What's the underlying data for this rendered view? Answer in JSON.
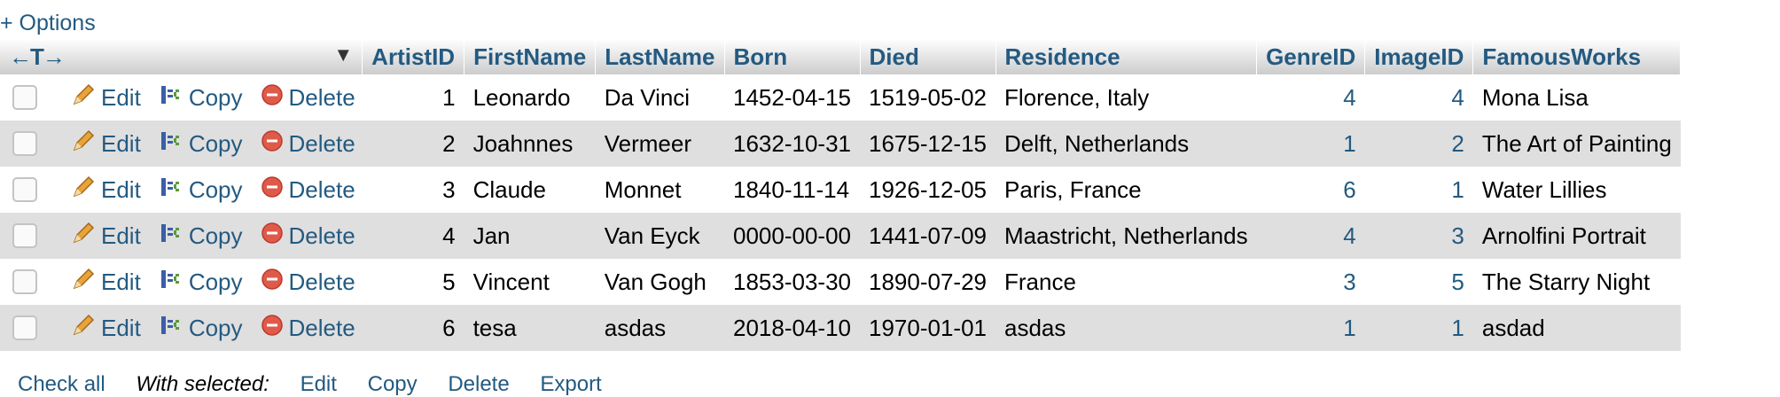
{
  "options_label": "+ Options",
  "toolbar": {
    "sort_arrows": "←T→"
  },
  "columns": [
    "ArtistID",
    "FirstName",
    "LastName",
    "Born",
    "Died",
    "Residence",
    "GenreID",
    "ImageID",
    "FamousWorks"
  ],
  "row_actions": {
    "edit": "Edit",
    "copy": "Copy",
    "delete": "Delete"
  },
  "rows": [
    {
      "id": "1",
      "first": "Leonardo",
      "last": "Da Vinci",
      "born": "1452-04-15",
      "died": "1519-05-02",
      "residence": "Florence, Italy",
      "genre": "4",
      "image": "4",
      "works": "Mona Lisa"
    },
    {
      "id": "2",
      "first": "Joahnnes",
      "last": "Vermeer",
      "born": "1632-10-31",
      "died": "1675-12-15",
      "residence": "Delft, Netherlands",
      "genre": "1",
      "image": "2",
      "works": "The Art of Painting"
    },
    {
      "id": "3",
      "first": "Claude",
      "last": "Monnet",
      "born": "1840-11-14",
      "died": "1926-12-05",
      "residence": "Paris, France",
      "genre": "6",
      "image": "1",
      "works": "Water Lillies"
    },
    {
      "id": "4",
      "first": "Jan",
      "last": "Van Eyck",
      "born": "0000-00-00",
      "died": "1441-07-09",
      "residence": "Maastricht, Netherlands",
      "genre": "4",
      "image": "3",
      "works": "Arnolfini Portrait"
    },
    {
      "id": "5",
      "first": "Vincent",
      "last": "Van Gogh",
      "born": "1853-03-30",
      "died": "1890-07-29",
      "residence": "France",
      "genre": "3",
      "image": "5",
      "works": "The Starry Night"
    },
    {
      "id": "6",
      "first": "tesa",
      "last": "asdas",
      "born": "2018-04-10",
      "died": "1970-01-01",
      "residence": "asdas",
      "genre": "1",
      "image": "1",
      "works": "asdad"
    }
  ],
  "bottom": {
    "check_all": "Check all",
    "with_selected": "With selected:",
    "edit": "Edit",
    "copy": "Copy",
    "delete": "Delete",
    "export": "Export"
  },
  "colors": {
    "link": "#235a81",
    "row_alt": "#dfdfdf",
    "delete_icon": "#e05a4a",
    "pencil": "#e8a33a"
  }
}
